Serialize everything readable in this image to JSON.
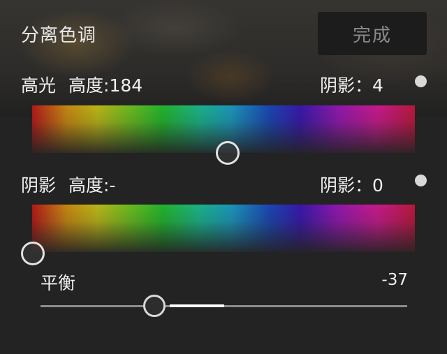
{
  "header": {
    "title": "分离色调",
    "done_label": "完成"
  },
  "highlights": {
    "label": "高光",
    "hue_label": "高度:184",
    "sat_label": "阴影：",
    "sat_value": "4",
    "hue_handle_fraction": 0.511
  },
  "shadows": {
    "label": "阴影",
    "hue_label": "高度:-",
    "sat_label": "阴影：",
    "sat_value": "0",
    "hue_handle_fraction": 0.0
  },
  "balance": {
    "label": "平衡",
    "value": "-37",
    "position_fraction": 0.31
  },
  "colors": {
    "background": "#232323",
    "dot": "#d9d9d9",
    "handle_ring": "#e2e2e2",
    "track": "#8c8c8c",
    "track_fill": "#ffffff"
  }
}
